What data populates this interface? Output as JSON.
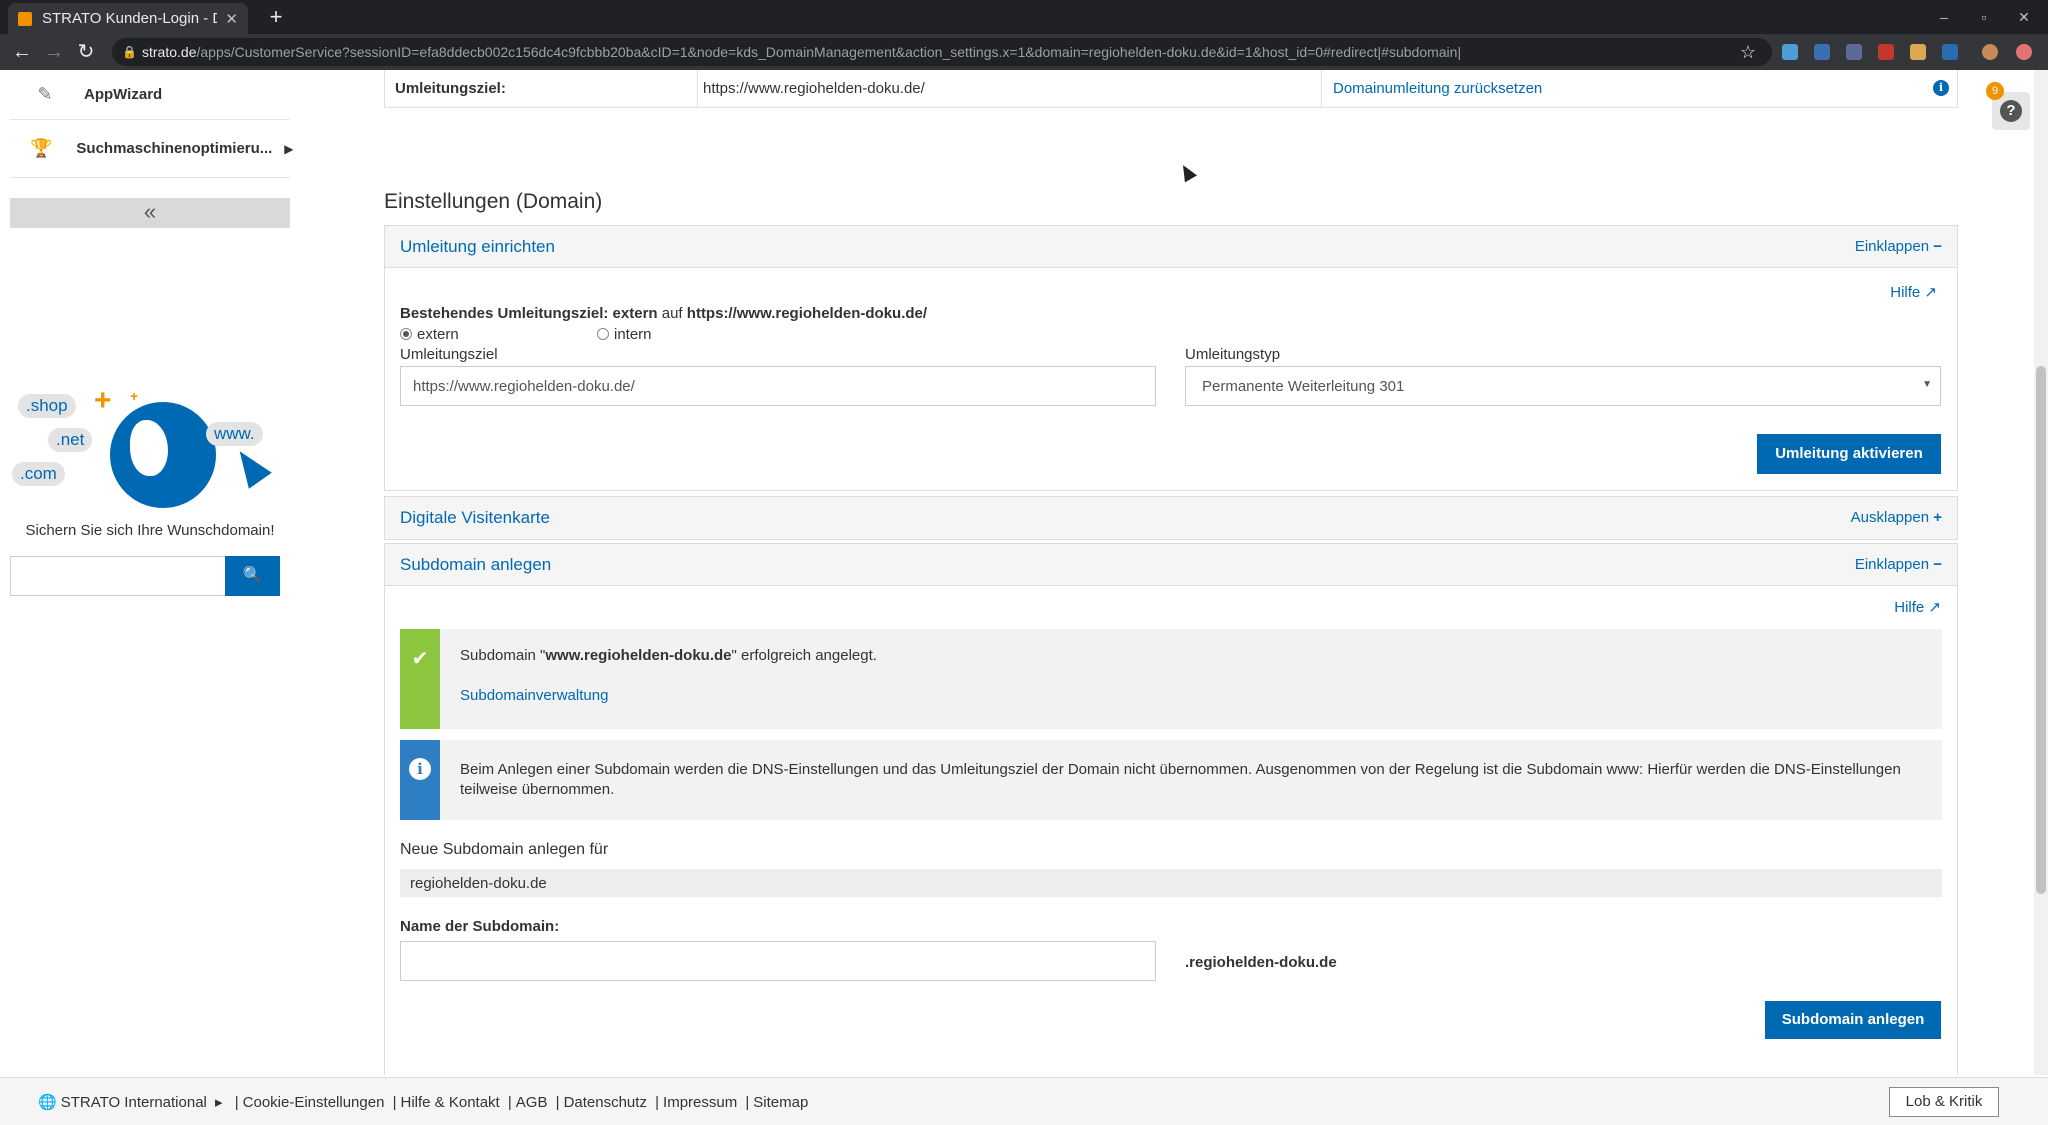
{
  "browser": {
    "tab_title": "STRATO Kunden-Login - D",
    "url_host": "strato.de",
    "url_path": "/apps/CustomerService?sessionID=efa8ddecb002c156dc4c9fcbbb20ba&cID=1&node=kds_DomainManagement&action_settings.x=1&domain=regiohelden-doku.de&id=1&host_id=0#redirect|#subdomain|"
  },
  "sidebar": {
    "items": [
      {
        "label": "AppWizard",
        "icon": "magic-wand-icon"
      },
      {
        "label": "Suchmaschinenoptimieru...",
        "icon": "trophy-icon"
      }
    ],
    "collapse_label": "«",
    "promo": {
      "tld_shop": ".shop",
      "tld_net": ".net",
      "tld_com": ".com",
      "www": "www.",
      "text": "Sichern Sie sich Ihre Wunschdomain!"
    },
    "search_placeholder": ""
  },
  "top_row": {
    "label": "Umleitungsziel:",
    "value": "https://www.regiohelden-doku.de/",
    "action": "Domainumleitung zurücksetzen"
  },
  "section_title": "Einstellungen (Domain)",
  "redirect_panel": {
    "title": "Umleitung einrichten",
    "toggle": "Einklappen",
    "help": "Hilfe",
    "existing_prefix": "Bestehendes Umleitungsziel: extern",
    "existing_mid": "auf",
    "existing_url": "https://www.regiohelden-doku.de/",
    "radio_extern": "extern",
    "radio_intern": "intern",
    "target_label": "Umleitungsziel",
    "target_value": "https://www.regiohelden-doku.de/",
    "type_label": "Umleitungstyp",
    "type_value": "Permanente Weiterleitung 301",
    "activate_button": "Umleitung aktivieren"
  },
  "vcard_panel": {
    "title": "Digitale Visitenkarte",
    "toggle": "Ausklappen"
  },
  "subdomain_panel": {
    "title": "Subdomain anlegen",
    "toggle": "Einklappen",
    "help": "Hilfe",
    "success_prefix": "Subdomain \"",
    "success_name": "www.regiohelden-doku.de",
    "success_suffix": "\" erfolgreich angelegt.",
    "success_link": "Subdomainverwaltung",
    "info_text": "Beim Anlegen einer Subdomain werden die DNS-Einstellungen und das Umleitungsziel der Domain nicht übernommen. Ausgenommen von der Regelung ist die Subdomain www: Hierfür werden die DNS-Einstellungen teilweise übernommen.",
    "new_for_label": "Neue Subdomain anlegen für",
    "domain_value": "regiohelden-doku.de",
    "name_label": "Name der Subdomain:",
    "name_value": "",
    "suffix": ".regiohelden-doku.de",
    "create_button": "Subdomain anlegen"
  },
  "footer": {
    "links": [
      "STRATO International",
      "Cookie-Einstellungen",
      "Hilfe & Kontakt",
      "AGB",
      "Datenschutz",
      "Impressum",
      "Sitemap"
    ],
    "feedback": "Lob & Kritik"
  },
  "help_badge": "9",
  "colors": {
    "accent": "#0069b4",
    "orange": "#f39200",
    "success": "#8cc63f"
  }
}
